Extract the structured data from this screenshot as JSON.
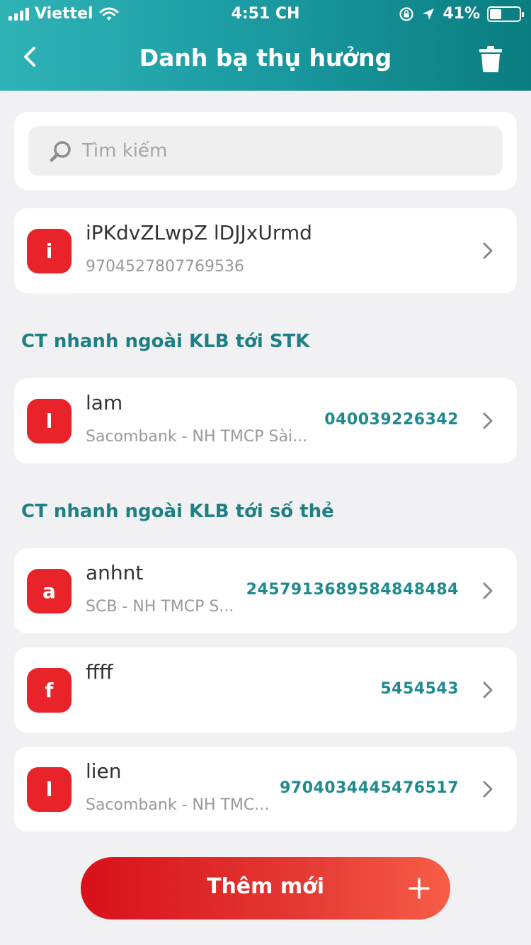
{
  "status_bar": {
    "carrier": "Viettel",
    "time": "4:51 CH",
    "battery": "41%",
    "battery_level": 0.41
  },
  "header": {
    "title": "Danh bạ thụ hưởng",
    "back_icon": "chevron-left-icon",
    "delete_icon": "trash-icon"
  },
  "search": {
    "placeholder": "Tìm kiếm"
  },
  "contacts": [
    {
      "initial": "i",
      "name": "iPKdvZLwpZ lDJJxUrmd",
      "subtitle": "9704527807769536",
      "account": ""
    }
  ],
  "sections": [
    {
      "title": "CT nhanh ngoài KLB tới STK",
      "items": [
        {
          "initial": "l",
          "name": "lam",
          "subtitle": "Sacombank - NH TMCP Sài...",
          "account": "040039226342"
        }
      ]
    },
    {
      "title": "CT nhanh ngoài KLB tới số thẻ",
      "items": [
        {
          "initial": "a",
          "name": "anhnt",
          "subtitle": "SCB - NH TMCP S...",
          "account": "2457913689584848484"
        },
        {
          "initial": "f",
          "name": "ffff",
          "subtitle": "",
          "account": "5454543"
        },
        {
          "initial": "l",
          "name": "lien",
          "subtitle": "Sacombank - NH TMC...",
          "account": "9704034445476517"
        }
      ]
    }
  ],
  "footer": {
    "add_label": "Thêm mới",
    "add_icon": "plus-icon"
  },
  "colors": {
    "header_start": "#2fb3b7",
    "header_end": "#0a7d80",
    "accent_teal": "#1e8a8e",
    "avatar_red": "#e8232a",
    "button_red_start": "#d8101a",
    "button_red_end": "#f75d47"
  }
}
